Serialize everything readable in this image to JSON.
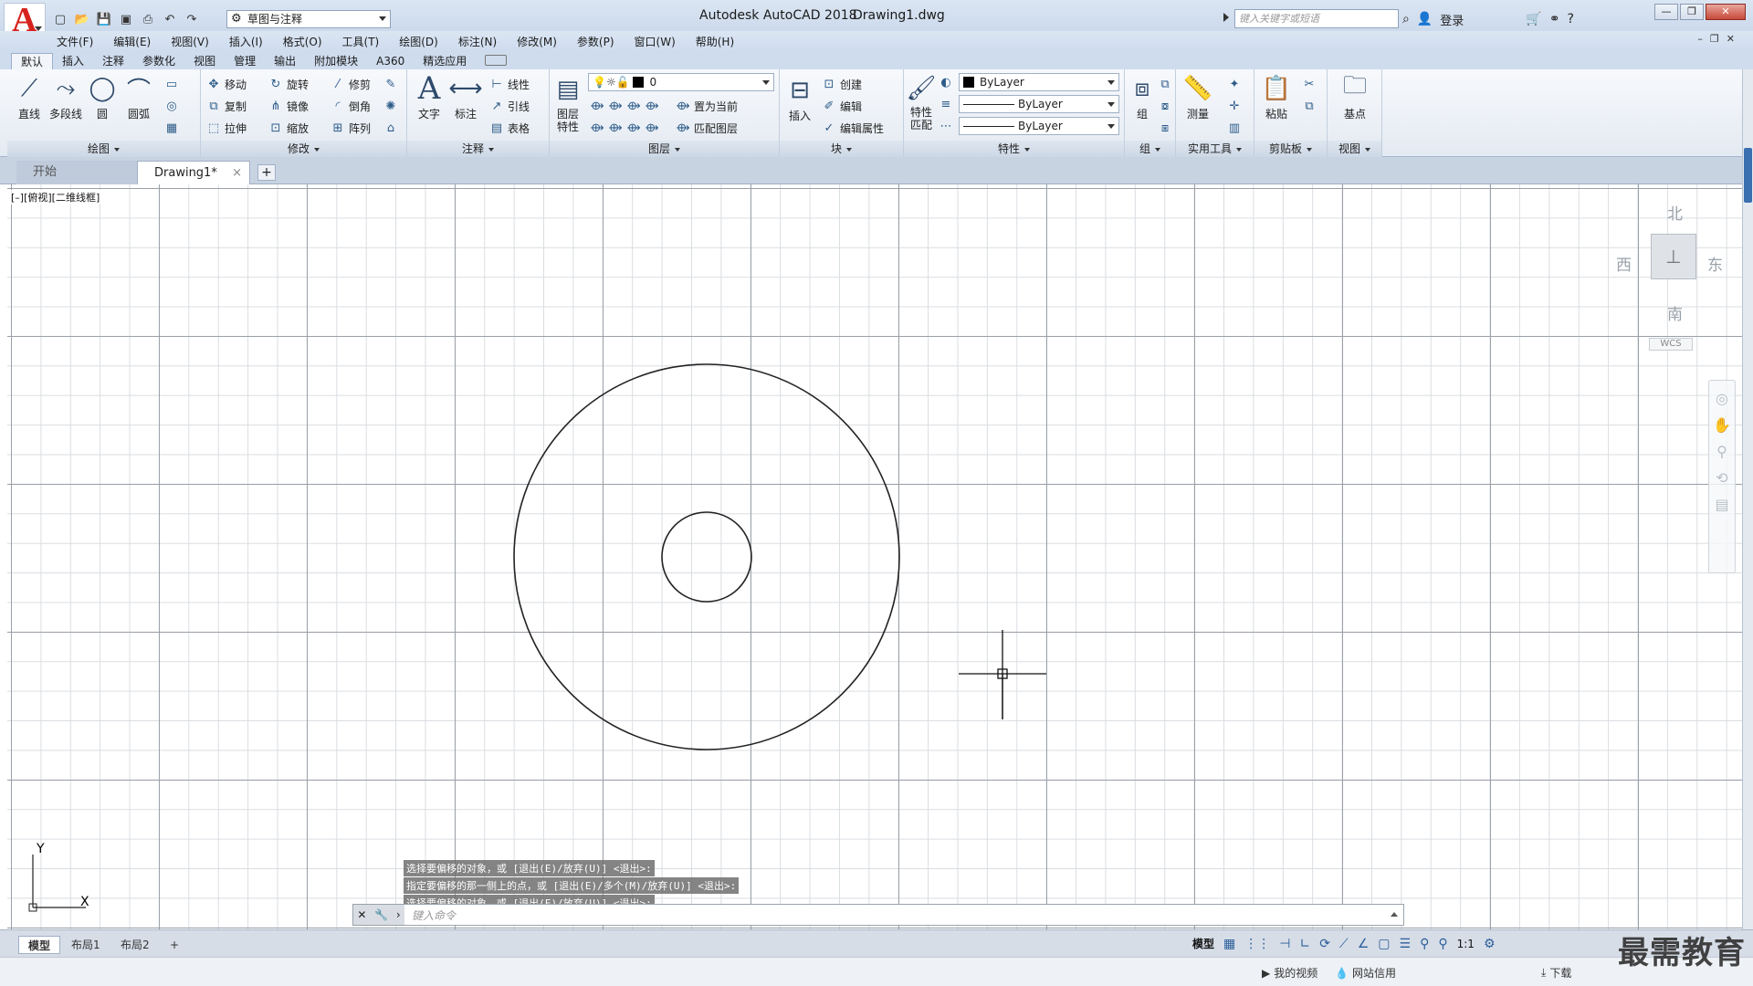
{
  "app": {
    "title": "Autodesk AutoCAD 2018",
    "file": "Drawing1.dwg",
    "logo_letter": "A",
    "workspace": "草图与注释",
    "search_placeholder": "键入关键字或短语",
    "login": "登录",
    "help": "?"
  },
  "menu": [
    "文件(F)",
    "编辑(E)",
    "视图(V)",
    "插入(I)",
    "格式(O)",
    "工具(T)",
    "绘图(D)",
    "标注(N)",
    "修改(M)",
    "参数(P)",
    "窗口(W)",
    "帮助(H)"
  ],
  "ribbon_tabs": [
    "默认",
    "插入",
    "注释",
    "参数化",
    "视图",
    "管理",
    "输出",
    "附加模块",
    "A360",
    "精选应用"
  ],
  "ribbon": {
    "draw": {
      "title": "绘图",
      "line": "直线",
      "polyline": "多段线",
      "circle": "圆",
      "arc": "圆弧"
    },
    "modify": {
      "title": "修改",
      "move": "移动",
      "rotate": "旋转",
      "trim": "修剪",
      "copy": "复制",
      "mirror": "镜像",
      "fillet": "倒角",
      "stretch": "拉伸",
      "scale": "缩放",
      "array": "阵列"
    },
    "annotation": {
      "title": "注释",
      "text": "文字",
      "dimension": "标注",
      "linear": "线性",
      "leader": "引线",
      "table": "表格"
    },
    "layers": {
      "title": "图层",
      "props": "图层\n特性",
      "props1": "图层",
      "props2": "特性",
      "current_layer": "0",
      "set_current": "置为当前",
      "match_layer": "匹配图层"
    },
    "block": {
      "title": "块",
      "insert": "插入",
      "create": "创建",
      "edit": "编辑",
      "edit_attr": "编辑属性"
    },
    "properties": {
      "title": "特性",
      "match": "特性",
      "match2": "匹配",
      "color": "ByLayer",
      "linetype": "ByLayer",
      "lineweight": "ByLayer"
    },
    "groups": {
      "title": "组",
      "group": "组"
    },
    "utilities": {
      "title": "实用工具",
      "measure": "测量"
    },
    "clipboard": {
      "title": "剪贴板",
      "paste": "粘贴"
    },
    "view": {
      "title": "视图",
      "base": "基点"
    }
  },
  "doc_tabs": {
    "start": "开始",
    "drawing": "Drawing1*",
    "close": "×",
    "add": "+"
  },
  "viewport_label": "[–][俯视][二维线框]",
  "viewcube": {
    "north": "北",
    "south": "南",
    "east": "东",
    "west": "西",
    "wcs": "WCS"
  },
  "ucs": {
    "x": "X",
    "y": "Y"
  },
  "command": {
    "history": [
      "选择要偏移的对象，或 [退出(E)/放弃(U)] <退出>:",
      "指定要偏移的那一侧上的点，或 [退出(E)/多个(M)/放弃(U)] <退出>:",
      "选择要偏移的对象，或 [退出(E)/放弃(U)] <退出>:"
    ],
    "prompt": "键入命令"
  },
  "layout_tabs": [
    "模型",
    "布局1",
    "布局2"
  ],
  "status": {
    "model": "模型",
    "scale": "1:1"
  },
  "taskbar": {
    "video": "我的视频",
    "network": "网站信用",
    "download": "下载"
  },
  "watermark": "最需教育",
  "colors": {
    "accent": "#d6221c",
    "grid_major": "#9aa0a8",
    "grid_minor": "#dadde1"
  }
}
